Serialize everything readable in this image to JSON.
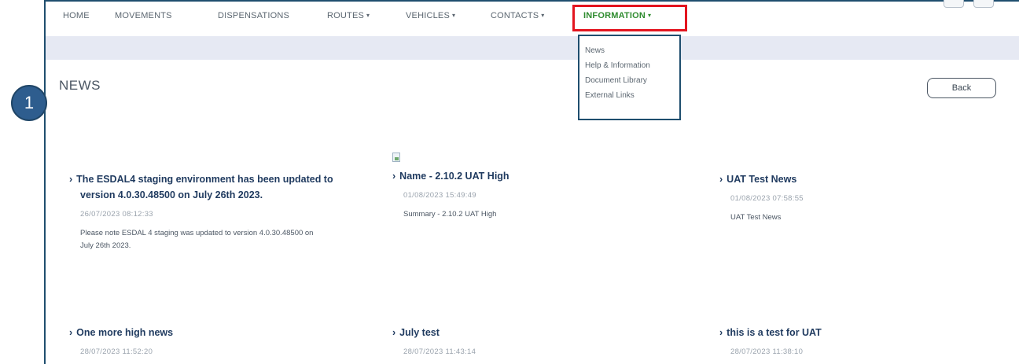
{
  "nav": {
    "home": "HOME",
    "movements": "MOVEMENTS",
    "dispensations": "DISPENSATIONS",
    "routes": "ROUTES",
    "vehicles": "VEHICLES",
    "contacts": "CONTACTS",
    "information": "INFORMATION",
    "caret": "▾"
  },
  "dropdown": {
    "items": [
      "News",
      "Help & Information",
      "Document Library",
      "External Links"
    ]
  },
  "page": {
    "title": "NEWS",
    "back_label": "Back"
  },
  "marker": {
    "number": "1",
    "color": "#2e5d8e"
  },
  "news": [
    {
      "title_line1": "The ESDAL4 staging environment has been updated to",
      "title_line2": "version 4.0.30.48500 on July 26th 2023.",
      "date": "26/07/2023 08:12:33",
      "summary_line1": "Please note ESDAL 4 staging was updated to version 4.0.30.48500 on",
      "summary_line2": "July 26th 2023."
    },
    {
      "title_line1": "Name - 2.10.2 UAT High",
      "date": "01/08/2023 15:49:49",
      "summary_line1": "Summary - 2.10.2 UAT High"
    },
    {
      "title_line1": "UAT Test News",
      "date": "01/08/2023 07:58:55",
      "summary_line1": "UAT Test News"
    },
    {
      "title_line1": "One more high news",
      "date": "28/07/2023 11:52:20"
    },
    {
      "title_line1": "July test",
      "date": "28/07/2023 11:43:14"
    },
    {
      "title_line1": "this is a test for UAT",
      "date": "28/07/2023 11:38:10"
    }
  ],
  "colors": {
    "active_nav": "#2e8b2e",
    "highlight": "#e3151f",
    "frame_border": "#1f4e6e",
    "subbar": "#e6e9f3"
  }
}
